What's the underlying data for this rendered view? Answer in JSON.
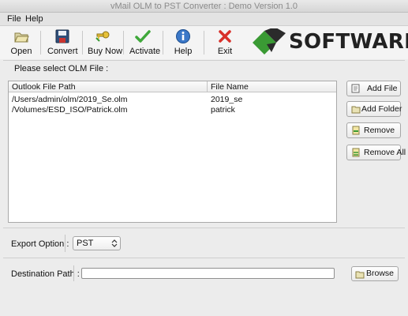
{
  "window": {
    "title": "vMail OLM to PST Converter : Demo Version 1.0"
  },
  "menu": {
    "items": [
      "File",
      "Help"
    ]
  },
  "toolbar": {
    "buttons": [
      {
        "label": "Open",
        "icon": "folder-open-icon"
      },
      {
        "label": "Convert",
        "icon": "floppy-save-icon"
      },
      {
        "label": "Buy Now",
        "icon": "key-icon"
      },
      {
        "label": "Activate",
        "icon": "checkmark-icon"
      },
      {
        "label": "Help",
        "icon": "info-icon"
      },
      {
        "label": "Exit",
        "icon": "red-x-icon"
      }
    ]
  },
  "logo": {
    "text": "SOFTWARE",
    "colors": {
      "green": "#3a9a34",
      "dark": "#2b2b2b"
    }
  },
  "file_section": {
    "prompt": "Please select OLM File :",
    "columns": [
      "Outlook File Path",
      "File Name"
    ],
    "rows": [
      {
        "path": "/Users/admin/olm/2019_Se.olm",
        "name": "2019_se"
      },
      {
        "path": "/Volumes/ESD_ISO/Patrick.olm",
        "name": "patrick"
      }
    ],
    "buttons": {
      "add_file": "Add File",
      "add_folder": "Add Folder",
      "remove": "Remove",
      "remove_all": "Remove All"
    }
  },
  "export": {
    "label": "Export Option :",
    "selected": "PST"
  },
  "destination": {
    "label": "Destination Path :",
    "value": "",
    "browse": "Browse"
  }
}
